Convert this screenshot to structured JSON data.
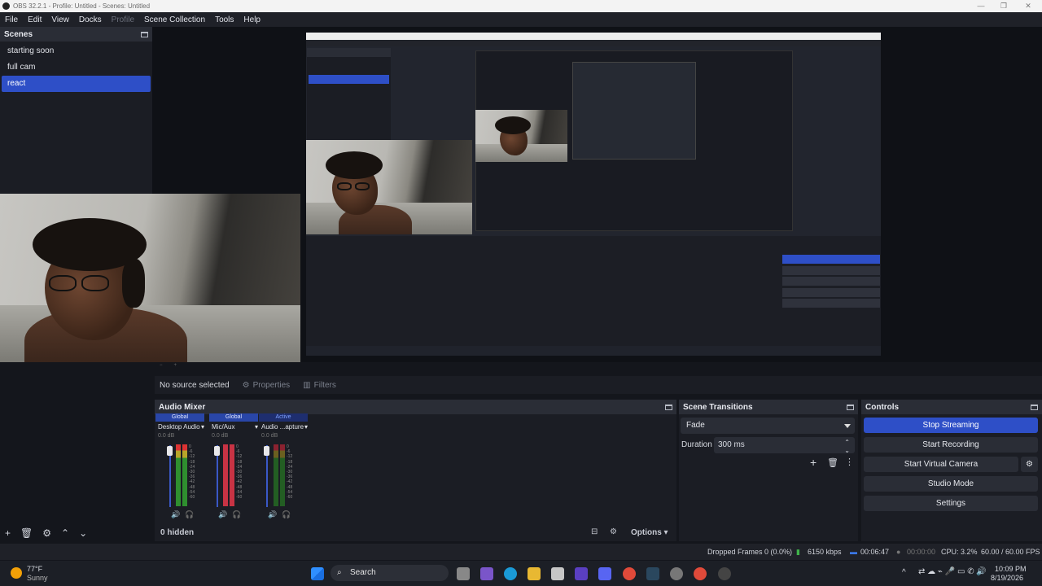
{
  "window": {
    "title": "OBS 32.2.1 - Profile: Untitled - Scenes: Untitled"
  },
  "menu": [
    "File",
    "Edit",
    "View",
    "Docks",
    "Profile",
    "Scene Collection",
    "Tools",
    "Help"
  ],
  "scenes": {
    "title": "Scenes",
    "items": [
      "starting soon",
      "full cam",
      "react"
    ],
    "selected": "react"
  },
  "source_bar": {
    "no_source": "No source selected",
    "properties": "Properties",
    "filters": "Filters"
  },
  "audio_mixer": {
    "title": "Audio Mixer",
    "channels": [
      {
        "tag": "Global",
        "name": "Desktop Audio",
        "db": "0.0 dB"
      },
      {
        "tag": "Global",
        "name": "Mic/Aux",
        "db": "0.0 dB"
      },
      {
        "tag": "Active",
        "name": "Audio ...apture",
        "db": "0.0 dB"
      }
    ],
    "ticks": [
      "0",
      "-6",
      "-12",
      "-18",
      "-24",
      "-30",
      "-36",
      "-42",
      "-48",
      "-54",
      "-60"
    ],
    "hidden": "0 hidden",
    "options": "Options"
  },
  "scene_transitions": {
    "title": "Scene Transitions",
    "transition": "Fade",
    "duration_label": "Duration",
    "duration_value": "300 ms"
  },
  "controls": {
    "title": "Controls",
    "stop_streaming": "Stop Streaming",
    "start_recording": "Start Recording",
    "start_virtual_camera": "Start Virtual Camera",
    "studio_mode": "Studio Mode",
    "settings": "Settings"
  },
  "status": {
    "dropped": "Dropped Frames 0 (0.0%)",
    "bitrate": "6150 kbps",
    "stream_time": "00:06:47",
    "rec_time": "00:00:00",
    "cpu": "CPU: 3.2%",
    "fps": "60.00 / 60.00 FPS"
  },
  "taskbar": {
    "weather_temp": "77°F",
    "weather_desc": "Sunny",
    "search": "Search",
    "time": "10:09 PM",
    "date": "8/19/2026"
  },
  "colors": {
    "accent": "#2e4fc7",
    "panel": "#1b1d24",
    "background": "#14161c"
  }
}
